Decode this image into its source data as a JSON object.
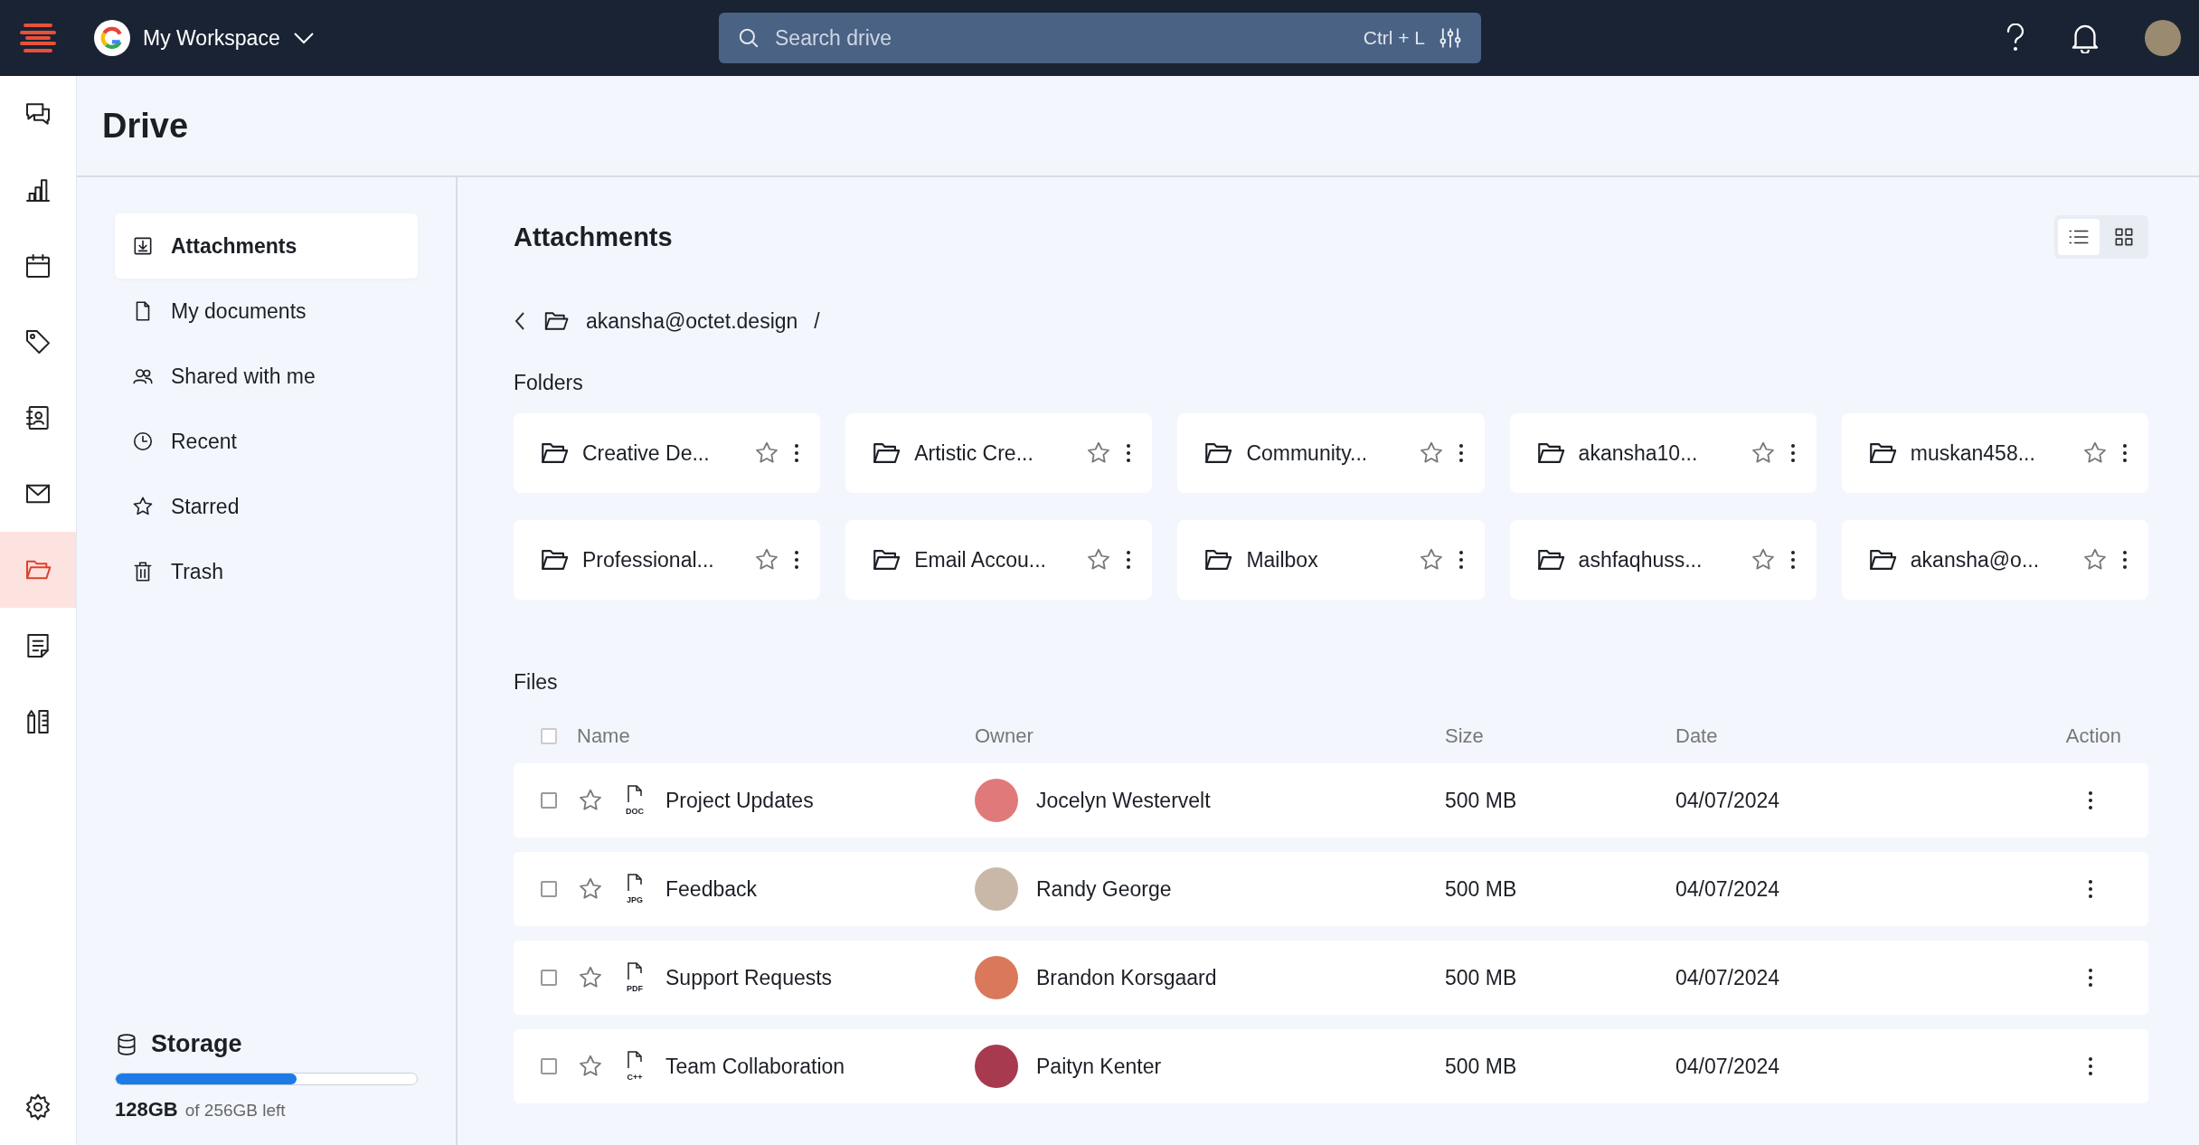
{
  "topbar": {
    "workspace": "My Workspace",
    "search": {
      "placeholder": "Search drive",
      "shortcut": "Ctrl + L"
    }
  },
  "rail": [
    {
      "kind": "chat",
      "selected": false
    },
    {
      "kind": "chart",
      "selected": false
    },
    {
      "kind": "calendar",
      "selected": false
    },
    {
      "kind": "tag",
      "selected": false
    },
    {
      "kind": "contacts",
      "selected": false
    },
    {
      "kind": "mail",
      "selected": false
    },
    {
      "kind": "folder",
      "selected": true
    },
    {
      "kind": "notes",
      "selected": false
    },
    {
      "kind": "tools",
      "selected": false
    }
  ],
  "page_title": "Drive",
  "sidebar": {
    "items": [
      {
        "label": "Attachments",
        "kind": "download",
        "selected": true
      },
      {
        "label": "My documents",
        "kind": "document",
        "selected": false
      },
      {
        "label": "Shared with me",
        "kind": "people",
        "selected": false
      },
      {
        "label": "Recent",
        "kind": "clock",
        "selected": false
      },
      {
        "label": "Starred",
        "kind": "star",
        "selected": false
      },
      {
        "label": "Trash",
        "kind": "trash",
        "selected": false
      }
    ],
    "storage": {
      "title": "Storage",
      "level": 0.6,
      "used": "128GB",
      "detail": "of 256GB left"
    }
  },
  "content": {
    "title": "Attachments",
    "view_toggle": [
      {
        "kind": "list",
        "selected": true
      },
      {
        "kind": "grid",
        "selected": false
      }
    ],
    "breadcrumb": {
      "folder": "akansha@octet.design",
      "separator": "/"
    },
    "folders_label": "Folders",
    "folders": [
      {
        "name": "Creative De...",
        "starred": false
      },
      {
        "name": "Artistic Cre...",
        "starred": false
      },
      {
        "name": "Community...",
        "starred": false
      },
      {
        "name": "akansha10...",
        "starred": false
      },
      {
        "name": "muskan458...",
        "starred": false
      },
      {
        "name": "Professional...",
        "starred": false
      },
      {
        "name": "Email Accou...",
        "starred": false
      },
      {
        "name": "Mailbox",
        "starred": false
      },
      {
        "name": "ashfaqhuss...",
        "starred": false
      },
      {
        "name": "akansha@o...",
        "starred": false
      }
    ],
    "files_label": "Files",
    "table": {
      "all_checked": false,
      "columns": [
        "Name",
        "Owner",
        "Size",
        "Date",
        "Action"
      ],
      "rows": [
        {
          "checked": false,
          "starred": false,
          "type_label": "DOC",
          "name": "Project Updates",
          "owner": "Jocelyn Westervelt",
          "size": "500 MB",
          "date": "04/07/2024"
        },
        {
          "checked": false,
          "starred": false,
          "type_label": "JPG",
          "name": "Feedback",
          "owner": "Randy George",
          "size": "500 MB",
          "date": "04/07/2024"
        },
        {
          "checked": false,
          "starred": false,
          "type_label": "PDF",
          "name": "Support Requests",
          "owner": "Brandon Korsgaard",
          "size": "500 MB",
          "date": "04/07/2024"
        },
        {
          "checked": false,
          "starred": false,
          "type_label": "C++",
          "name": "Team Collaboration",
          "owner": "Paityn Kenter",
          "size": "500 MB",
          "date": "04/07/2024"
        }
      ]
    }
  }
}
